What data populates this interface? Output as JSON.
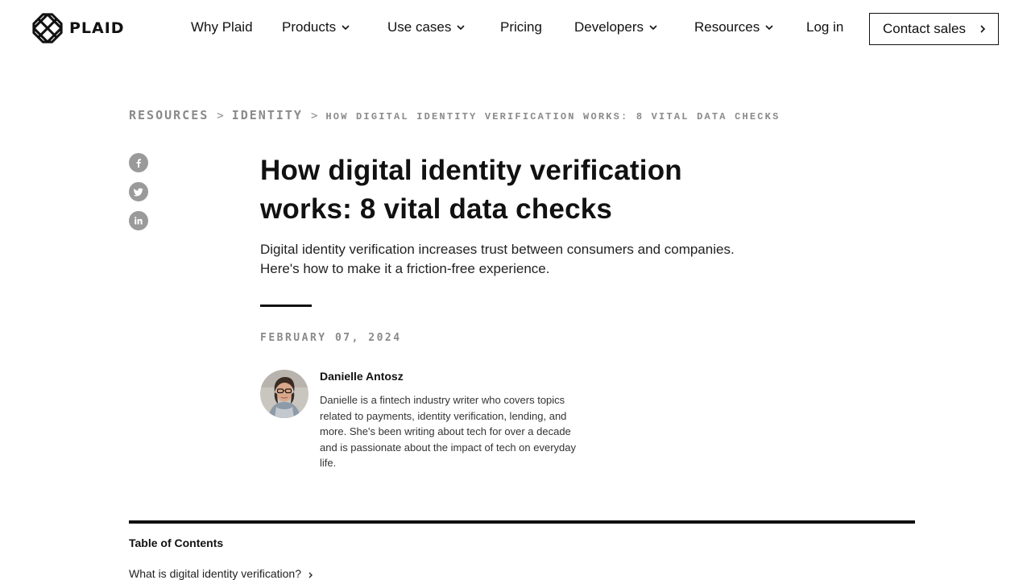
{
  "header": {
    "logo_text": "PLAID",
    "nav": [
      {
        "label": "Why Plaid",
        "dropdown": false
      },
      {
        "label": "Products",
        "dropdown": true
      },
      {
        "label": "Use cases",
        "dropdown": true
      },
      {
        "label": "Pricing",
        "dropdown": false
      },
      {
        "label": "Developers",
        "dropdown": true
      },
      {
        "label": "Resources",
        "dropdown": true
      },
      {
        "label": "Log in",
        "dropdown": false
      }
    ],
    "contact_label": "Contact sales"
  },
  "breadcrumb": {
    "items": [
      "RESOURCES",
      "IDENTITY"
    ],
    "separator": ">",
    "current": "HOW DIGITAL IDENTITY VERIFICATION WORKS: 8 VITAL DATA CHECKS"
  },
  "social": [
    "facebook-icon",
    "twitter-icon",
    "linkedin-icon"
  ],
  "article": {
    "title": "How digital identity verification works: 8 vital data checks",
    "subtitle": "Digital identity verification increases trust between consumers and companies. Here's how to make it a friction-free experience.",
    "date": "FEBRUARY 07, 2024"
  },
  "author": {
    "name": "Danielle Antosz",
    "bio": "Danielle is a fintech industry writer who covers topics related to payments, identity verification, lending, and more. She's been writing about tech for over a decade and is passionate about the impact of tech on everyday life."
  },
  "toc": {
    "title": "Table of Contents",
    "items": [
      "What is digital identity verification?"
    ]
  },
  "colors": {
    "text": "#111111",
    "muted": "#8a8a8a",
    "social_bg": "#9a9a9a"
  }
}
